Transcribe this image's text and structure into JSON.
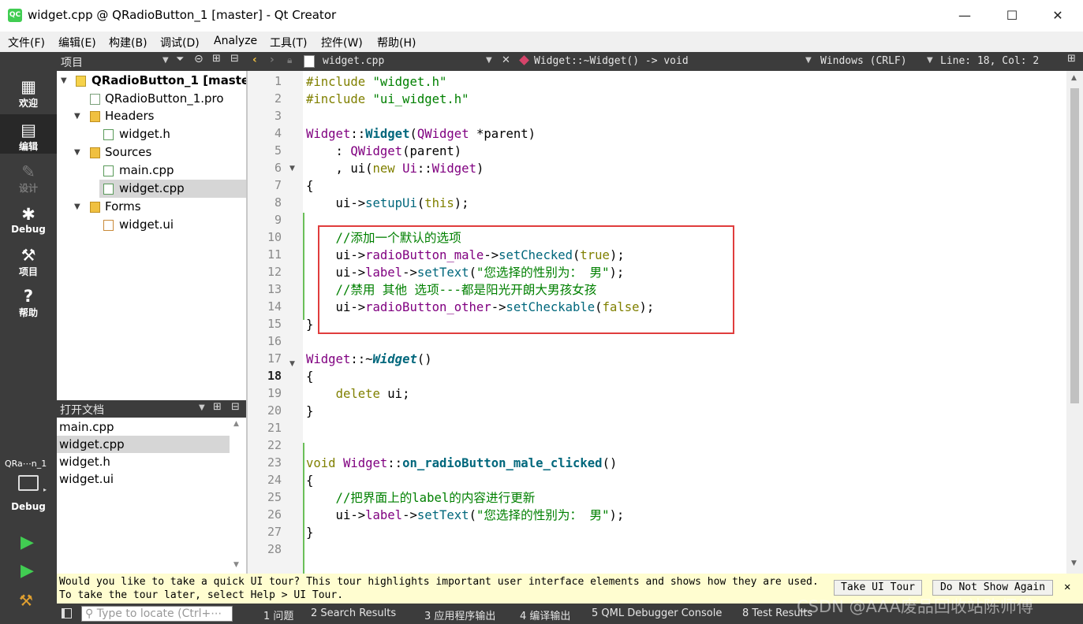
{
  "window": {
    "icon": "QC",
    "title": "widget.cpp @ QRadioButton_1 [master] - Qt Creator",
    "minimize": "—",
    "maximize": "☐",
    "close": "✕"
  },
  "menubar": {
    "items": [
      "文件(F)",
      "编辑(E)",
      "构建(B)",
      "调试(D)",
      "Analyze",
      "工具(T)",
      "控件(W)",
      "帮助(H)"
    ]
  },
  "toolbar": {
    "panel_title": "项目",
    "file_tab": "widget.cpp",
    "function": "Widget::~Widget() -> void",
    "line_ending": "Windows (CRLF)",
    "position": "Line: 18, Col: 2"
  },
  "modes": [
    {
      "label": "欢迎",
      "icon": "grid-icon"
    },
    {
      "label": "编辑",
      "icon": "edit-icon"
    },
    {
      "label": "设计",
      "icon": "pen-icon"
    },
    {
      "label": "Debug",
      "icon": "bug-icon"
    },
    {
      "label": "项目",
      "icon": "wrench-icon"
    },
    {
      "label": "帮助",
      "icon": "help-icon"
    }
  ],
  "kit": {
    "name": "QRa⋯n_1",
    "build": "Debug"
  },
  "project_tree": [
    {
      "label": "QRadioButton_1 [master]",
      "icon": "project-icon"
    },
    {
      "label": "QRadioButton_1.pro",
      "icon": "pro-file-icon"
    },
    {
      "label": "Headers",
      "icon": "folder-icon"
    },
    {
      "label": "widget.h",
      "icon": "header-file-icon"
    },
    {
      "label": "Sources",
      "icon": "folder-icon"
    },
    {
      "label": "main.cpp",
      "icon": "cpp-file-icon"
    },
    {
      "label": "widget.cpp",
      "icon": "cpp-file-icon"
    },
    {
      "label": "Forms",
      "icon": "folder-icon"
    },
    {
      "label": "widget.ui",
      "icon": "ui-file-icon"
    }
  ],
  "open_documents": {
    "title": "打开文档",
    "items": [
      "main.cpp",
      "widget.cpp",
      "widget.h",
      "widget.ui"
    ]
  },
  "editor": {
    "line_numbers": [
      "1",
      "2",
      "3",
      "4",
      "5",
      "6",
      "7",
      "8",
      "9",
      "10",
      "11",
      "12",
      "13",
      "14",
      "15",
      "16",
      "17",
      "18",
      "19",
      "20",
      "21",
      "22",
      "23",
      "24",
      "25",
      "26",
      "27",
      "28"
    ],
    "current_line": "18",
    "lines": [
      [
        {
          "t": "#include ",
          "c": "kw"
        },
        {
          "t": "\"widget.h\"",
          "c": "str"
        }
      ],
      [
        {
          "t": "#include ",
          "c": "kw"
        },
        {
          "t": "\"ui_widget.h\"",
          "c": "str"
        }
      ],
      [],
      [
        {
          "t": "Widget",
          "c": "cls"
        },
        {
          "t": "::",
          "c": ""
        },
        {
          "t": "Widget",
          "c": "fnb"
        },
        {
          "t": "(",
          "c": ""
        },
        {
          "t": "QWidget",
          "c": "cls"
        },
        {
          "t": " *parent)",
          "c": ""
        }
      ],
      [
        {
          "t": "    : ",
          "c": ""
        },
        {
          "t": "QWidget",
          "c": "cls"
        },
        {
          "t": "(parent)",
          "c": ""
        }
      ],
      [
        {
          "t": "    , ui(",
          "c": ""
        },
        {
          "t": "new",
          "c": "kw"
        },
        {
          "t": " ",
          "c": ""
        },
        {
          "t": "Ui",
          "c": "cls"
        },
        {
          "t": "::",
          "c": ""
        },
        {
          "t": "Widget",
          "c": "cls"
        },
        {
          "t": ")",
          "c": ""
        }
      ],
      [
        {
          "t": "{",
          "c": ""
        }
      ],
      [
        {
          "t": "    ui->",
          "c": ""
        },
        {
          "t": "setupUi",
          "c": "fn"
        },
        {
          "t": "(",
          "c": ""
        },
        {
          "t": "this",
          "c": "kw"
        },
        {
          "t": ");",
          "c": ""
        }
      ],
      [],
      [
        {
          "t": "    //添加一个默认的选项",
          "c": "cm"
        }
      ],
      [
        {
          "t": "    ui->",
          "c": ""
        },
        {
          "t": "radioButton_male",
          "c": "cls"
        },
        {
          "t": "->",
          "c": ""
        },
        {
          "t": "setChecked",
          "c": "fn"
        },
        {
          "t": "(",
          "c": ""
        },
        {
          "t": "true",
          "c": "kw"
        },
        {
          "t": ");",
          "c": ""
        }
      ],
      [
        {
          "t": "    ui->",
          "c": ""
        },
        {
          "t": "label",
          "c": "cls"
        },
        {
          "t": "->",
          "c": ""
        },
        {
          "t": "setText",
          "c": "fn"
        },
        {
          "t": "(",
          "c": ""
        },
        {
          "t": "\"您选择的性别为： 男\"",
          "c": "str"
        },
        {
          "t": ");",
          "c": ""
        }
      ],
      [
        {
          "t": "    //禁用 其他 选项---都是阳光开朗大男孩女孩",
          "c": "cm"
        }
      ],
      [
        {
          "t": "    ui->",
          "c": ""
        },
        {
          "t": "radioButton_other",
          "c": "cls"
        },
        {
          "t": "->",
          "c": ""
        },
        {
          "t": "setCheckable",
          "c": "fn"
        },
        {
          "t": "(",
          "c": ""
        },
        {
          "t": "false",
          "c": "kw"
        },
        {
          "t": ");",
          "c": ""
        }
      ],
      [
        {
          "t": "}",
          "c": ""
        }
      ],
      [],
      [
        {
          "t": "Widget",
          "c": "cls"
        },
        {
          "t": "::~",
          "c": ""
        },
        {
          "t": "Widget",
          "c": "fnb it"
        },
        {
          "t": "()",
          "c": ""
        }
      ],
      [
        {
          "t": "{",
          "c": ""
        }
      ],
      [
        {
          "t": "    ",
          "c": ""
        },
        {
          "t": "delete",
          "c": "kw"
        },
        {
          "t": " ui;",
          "c": ""
        }
      ],
      [
        {
          "t": "}",
          "c": ""
        }
      ],
      [],
      [],
      [
        {
          "t": "void",
          "c": "kw"
        },
        {
          "t": " ",
          "c": ""
        },
        {
          "t": "Widget",
          "c": "cls"
        },
        {
          "t": "::",
          "c": ""
        },
        {
          "t": "on_radioButton_male_clicked",
          "c": "fnb"
        },
        {
          "t": "()",
          "c": ""
        }
      ],
      [
        {
          "t": "{",
          "c": ""
        }
      ],
      [
        {
          "t": "    //把界面上的label的内容进行更新",
          "c": "cm"
        }
      ],
      [
        {
          "t": "    ui->",
          "c": ""
        },
        {
          "t": "label",
          "c": "cls"
        },
        {
          "t": "->",
          "c": ""
        },
        {
          "t": "setText",
          "c": "fn"
        },
        {
          "t": "(",
          "c": ""
        },
        {
          "t": "\"您选择的性别为： 男\"",
          "c": "str"
        },
        {
          "t": ");",
          "c": ""
        }
      ],
      [
        {
          "t": "}",
          "c": ""
        }
      ],
      []
    ]
  },
  "infobar": {
    "message": "Would you like to take a quick UI tour? This tour highlights important user interface elements and shows how they are used. To take the tour later, select Help > UI Tour.",
    "tour_button": "Take UI Tour",
    "dismiss_button": "Do Not Show Again",
    "close": "✕"
  },
  "statusbar": {
    "locator_placeholder": "Type to locate (Ctrl+⋯",
    "panes": [
      "1 问题",
      "2 Search Results",
      "3 应用程序输出",
      "4 编译输出",
      "5 QML Debugger Console",
      "8 Test Results"
    ]
  },
  "watermark": "CSDN @AAA废品回收站陈师傅",
  "colors": {
    "accent": "#41cd52",
    "sidebar": "#3c3c3c",
    "highlight_box": "#e03d3d",
    "change_bar": "#6bbf59"
  }
}
